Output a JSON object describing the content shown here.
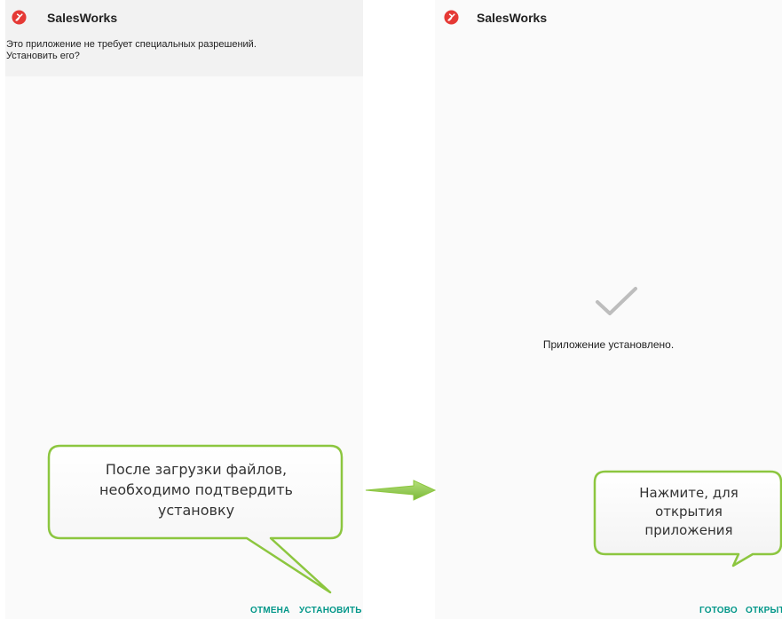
{
  "left_screen": {
    "app_name": "SalesWorks",
    "prompt_line1": "Это приложение не требует специальных разрешений.",
    "prompt_line2": "Установить его?",
    "cancel_label": "ОТМЕНА",
    "install_label": "УСТАНОВИТЬ"
  },
  "right_screen": {
    "app_name": "SalesWorks",
    "status_text": "Приложение установлено.",
    "done_label": "ГОТОВО",
    "open_label": "ОТКРЫТЬ"
  },
  "callouts": {
    "left": {
      "line1": "После загрузки файлов,",
      "line2": "необходимо подтвердить",
      "line3": "установку"
    },
    "right": {
      "line1": "Нажмите, для",
      "line2": "открытия",
      "line3": "приложения"
    }
  },
  "icons": {
    "app": "salesworks-logo-icon",
    "installed": "checkmark-icon",
    "transition": "right-arrow-icon"
  },
  "colors": {
    "accent": "#009688",
    "callout_border": "#8cc63f",
    "app_icon": "#e53935",
    "checkmark": "#bdbdbd"
  }
}
